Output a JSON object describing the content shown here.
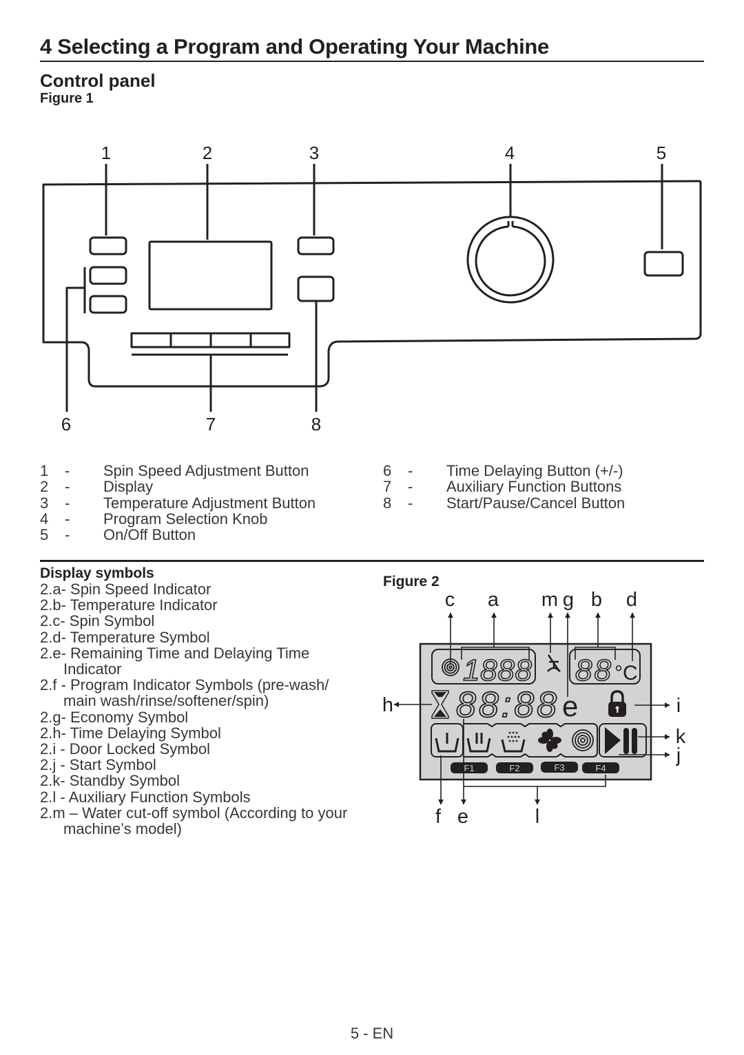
{
  "header": {
    "title": "4  Selecting a Program and Operating Your Machine",
    "section": "Control panel",
    "figure1_caption": "Figure 1"
  },
  "figure1": {
    "callouts_top": [
      "1",
      "2",
      "3",
      "4",
      "5"
    ],
    "callouts_bottom": [
      "6",
      "7",
      "8"
    ]
  },
  "legend": {
    "left": [
      {
        "num": "1",
        "dash": "-",
        "label": "Spin Speed Adjustment Button"
      },
      {
        "num": "2",
        "dash": "-",
        "label": "Display"
      },
      {
        "num": "3",
        "dash": "-",
        "label": "Temperature Adjustment Button"
      },
      {
        "num": "4",
        "dash": "-",
        "label": "Program Selection Knob"
      },
      {
        "num": "5",
        "dash": "-",
        "label": "On/Off Button"
      }
    ],
    "right": [
      {
        "num": "6",
        "dash": "-",
        "label": "Time Delaying Button (+/-)"
      },
      {
        "num": "7",
        "dash": "-",
        "label": "Auxiliary Function Buttons"
      },
      {
        "num": "8",
        "dash": "-",
        "label": "Start/Pause/Cancel Button"
      }
    ]
  },
  "display_symbols": {
    "title": "Display symbols",
    "items": [
      {
        "text": "2.a- Spin Speed Indicator"
      },
      {
        "text": "2.b- Temperature Indicator"
      },
      {
        "text": "2.c- Spin Symbol"
      },
      {
        "text": "2.d- Temperature Symbol"
      },
      {
        "text": "2.e- Remaining Time and Delaying Time",
        "cont": "Indicator"
      },
      {
        "text": "2.f - Program Indicator Symbols (pre-wash/",
        "cont": "main wash/rinse/softener/spin)"
      },
      {
        "text": "2.g- Economy Symbol"
      },
      {
        "text": "2.h- Time Delaying Symbol"
      },
      {
        "text": "2.i  - Door Locked Symbol"
      },
      {
        "text": "2.j  - Start Symbol"
      },
      {
        "text": "2.k- Standby Symbol"
      },
      {
        "text": "2.l  - Auxiliary Function Symbols"
      },
      {
        "text": "2.m – Water cut-off symbol (According to your",
        "cont": "machine’s model)"
      }
    ]
  },
  "figure2": {
    "caption": "Figure 2",
    "labels": {
      "c": "c",
      "a": "a",
      "m": "m",
      "g": "g",
      "b": "b",
      "d": "d",
      "h": "h",
      "i": "i",
      "k": "k",
      "j": "j",
      "f": "f",
      "e": "e",
      "l": "l"
    },
    "lcd": {
      "spin_digits": "1888",
      "temp_digits": "88",
      "temp_unit": "°C",
      "time_digits": "88:88",
      "economy": "e",
      "function_keys": [
        "F1",
        "F2",
        "F3",
        "F4"
      ],
      "background": "#d3d3d3"
    }
  },
  "footer": {
    "page": "5 - EN"
  }
}
